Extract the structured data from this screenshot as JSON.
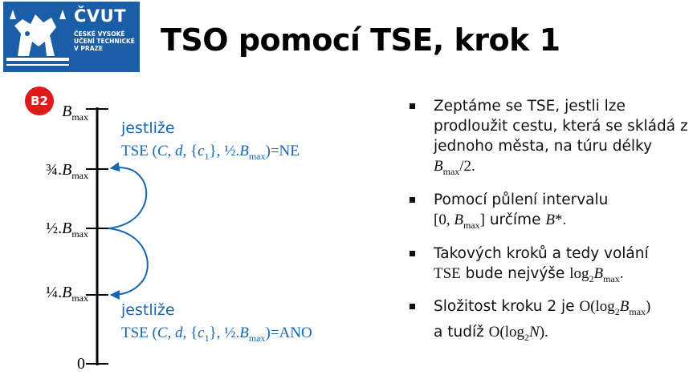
{
  "logo": {
    "name": "ČVUT",
    "lines": [
      "ČESKÉ VYSOKÉ",
      "UČENÍ TECHNICKÉ",
      "V PRAZE"
    ]
  },
  "title": "TSO pomocí TSE, krok 1",
  "badge": "B2",
  "axis": {
    "ticks": [
      {
        "frac": "",
        "var": "B",
        "sub": "max"
      },
      {
        "frac": "¾.",
        "var": "B",
        "sub": "max"
      },
      {
        "frac": "½.",
        "var": "B",
        "sub": "max"
      },
      {
        "frac": "¼.",
        "var": "B",
        "sub": "max"
      },
      {
        "frac": "0",
        "var": "",
        "sub": ""
      }
    ],
    "upper_note": {
      "word": "jestliže",
      "call_prefix": "TSE (",
      "args": "C, d",
      "set": ", {",
      "c": "c",
      "c_sub": "1",
      "half": "}, ½.",
      "B": "B",
      "B_sub": "max",
      "result": ")=NE"
    },
    "lower_note": {
      "word": "jestliže",
      "call_prefix": "TSE (",
      "args": "C, d",
      "set": ", {",
      "c": "c",
      "c_sub": "1",
      "half": "}, ½.",
      "B": "B",
      "B_sub": "max",
      "result": ")=ANO"
    }
  },
  "bullets": {
    "b1": {
      "text": "Zeptáme se TSE, jestli lze prodloužit cestu, která se skládá z jednoho města, na túru délky ",
      "B": "B",
      "B_sub": "max",
      "tail": "/2."
    },
    "b2": {
      "text1": "Pomocí půlení intervalu",
      "interval_pre": "[0, ",
      "B": "B",
      "B_sub": "max",
      "interval_post": "]",
      "mid": " určíme ",
      "Bstar": "B",
      "star": "*."
    },
    "b3": {
      "text1": "Takových kroků a tedy volání",
      "tse": "TSE",
      "mid": " bude nejvýše ",
      "log": "log",
      "log_sub": "2",
      "B": "B",
      "B_sub": "max",
      "tail": "."
    },
    "b4": {
      "text1": "Složitost kroku 2 je ",
      "O": "O(log",
      "O_sub": "2",
      "B": "B",
      "B_sub": "max",
      "close": ")",
      "text2": "a tudíž ",
      "O2": "O(log",
      "O2_sub": "2",
      "N": "N",
      "close2": ")."
    }
  },
  "colors": {
    "accent_blue": "#1565b3",
    "logo_blue": "#1a5ea8",
    "badge_red": "#e0191a"
  }
}
